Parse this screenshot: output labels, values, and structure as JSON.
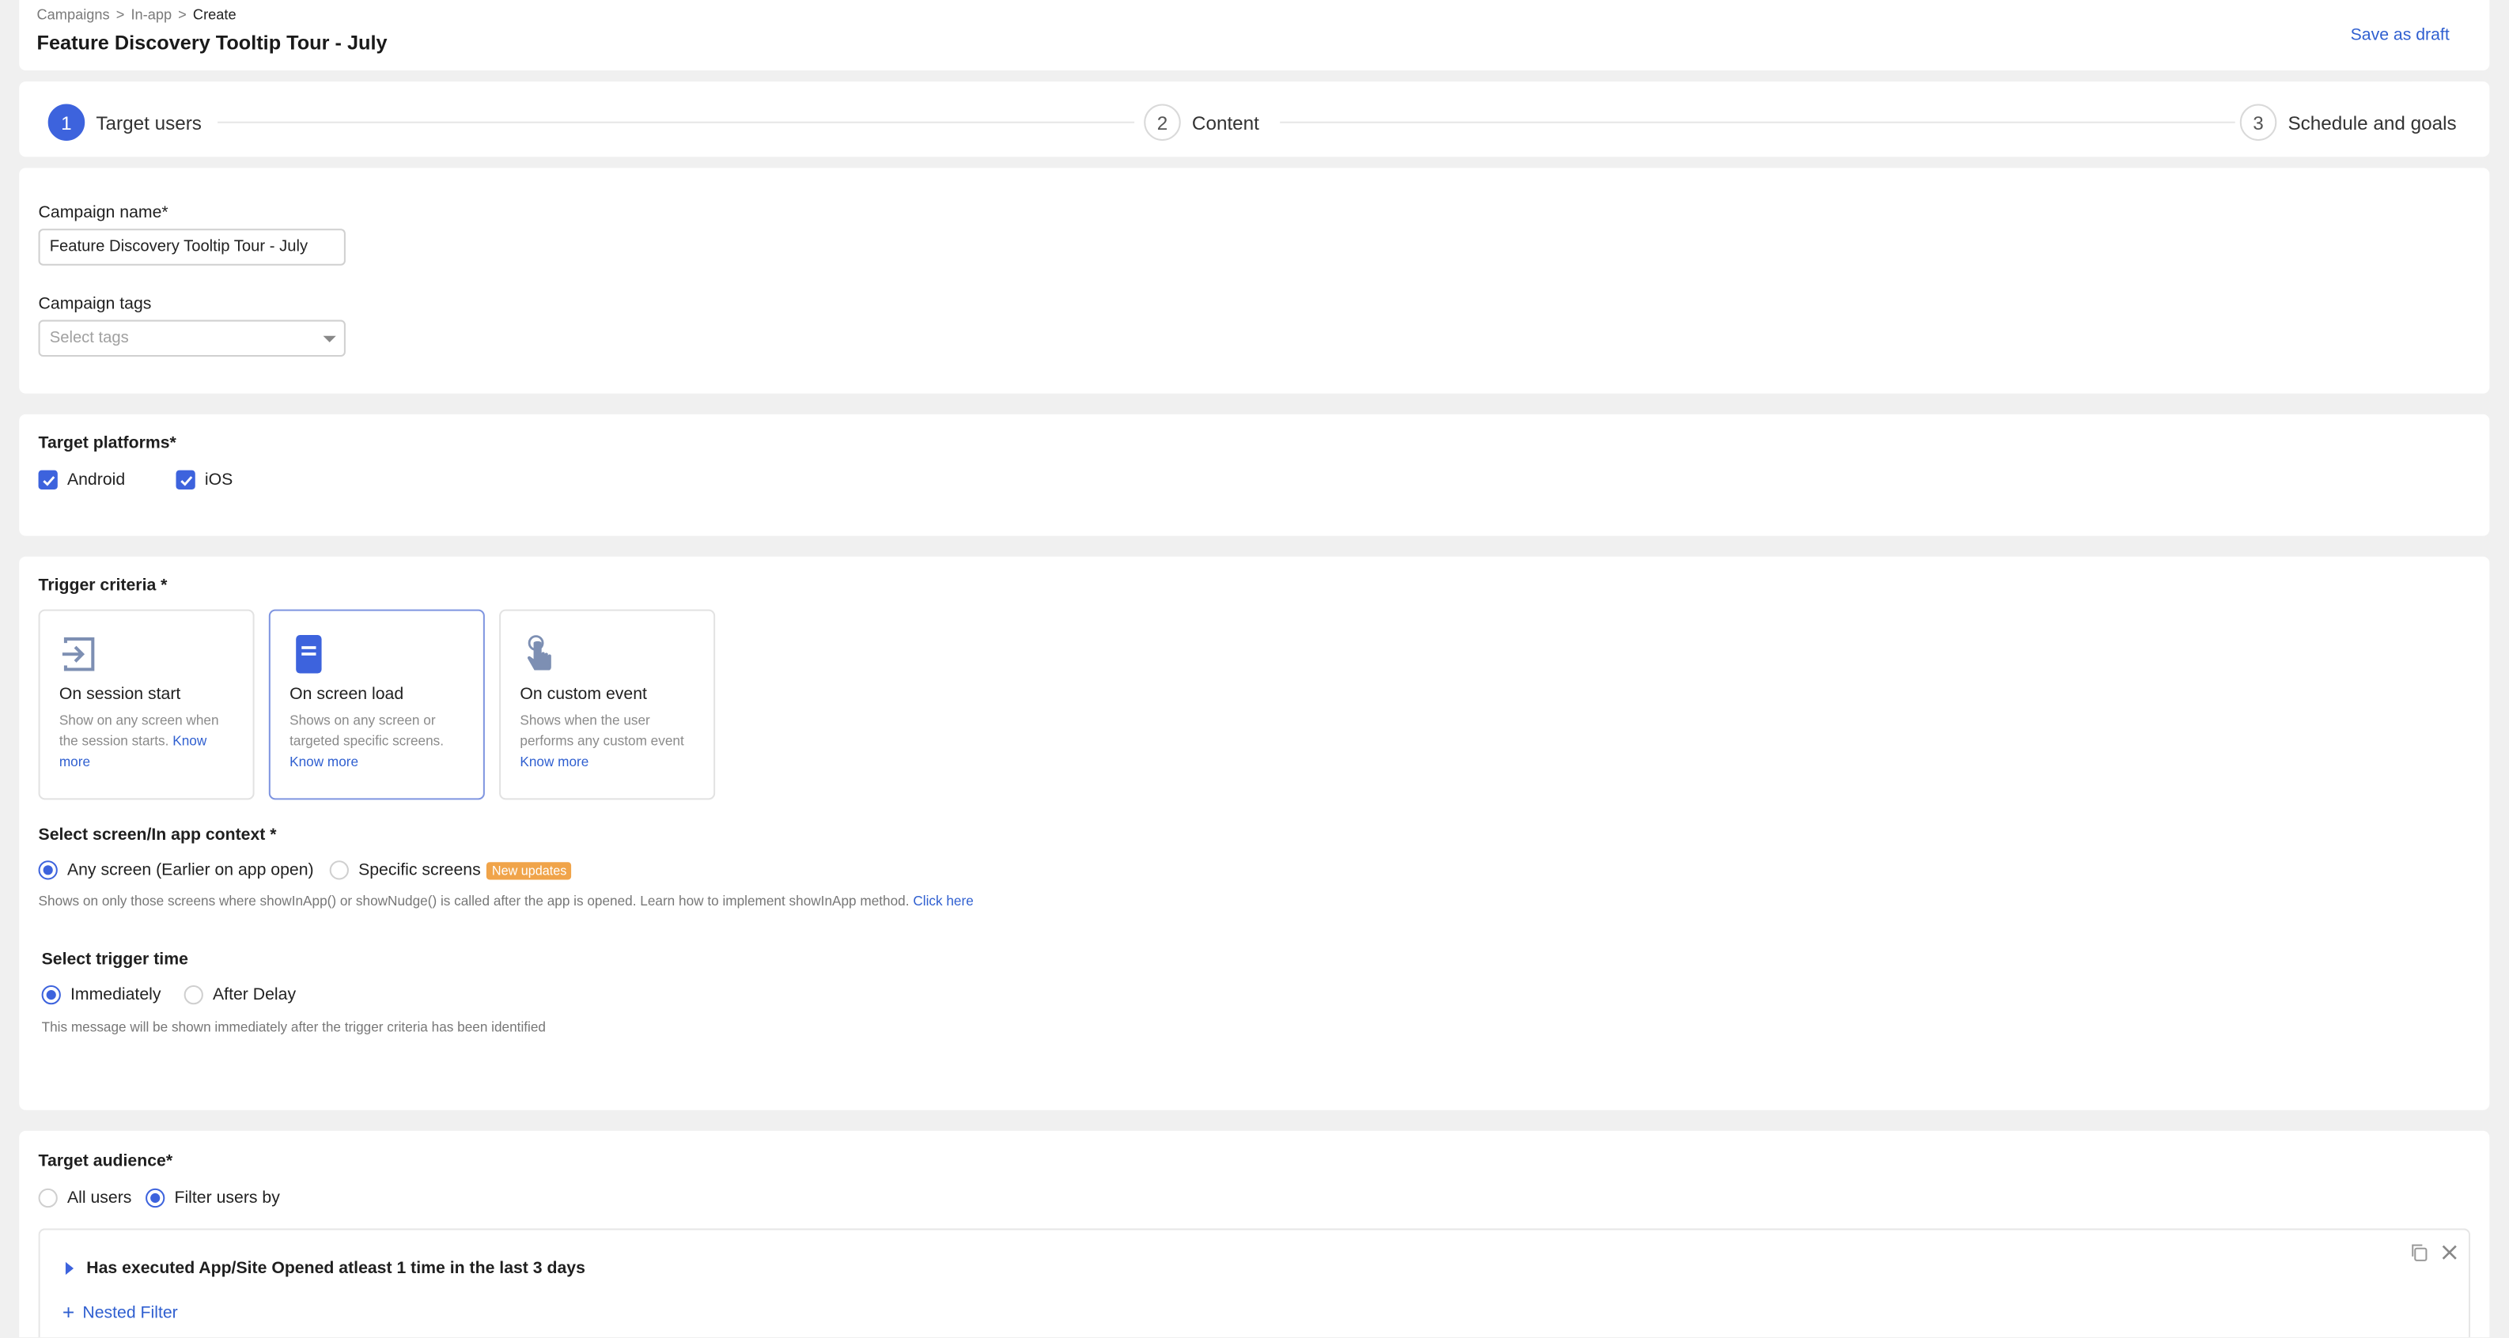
{
  "header": {
    "breadcrumb": [
      "Campaigns",
      "In-app",
      "Create"
    ],
    "breadcrumb_sep": ">",
    "title": "Feature Discovery Tooltip Tour - July",
    "save_draft": "Save as draft"
  },
  "steps": [
    {
      "num": "1",
      "label": "Target users",
      "active": true
    },
    {
      "num": "2",
      "label": "Content",
      "active": false
    },
    {
      "num": "3",
      "label": "Schedule and goals",
      "active": false
    }
  ],
  "campaign": {
    "name_label": "Campaign name*",
    "name_value": "Feature Discovery Tooltip Tour - July",
    "tags_label": "Campaign tags",
    "tags_placeholder": "Select tags"
  },
  "platforms": {
    "label": "Target platforms*",
    "android": "Android",
    "ios": "iOS"
  },
  "trigger": {
    "label": "Trigger criteria *",
    "tiles": [
      {
        "title": "On session start",
        "desc": "Show on any screen when the session starts.",
        "link": "Know more"
      },
      {
        "title": "On screen load",
        "desc": "Shows on any screen or targeted specific screens.",
        "link": "Know more"
      },
      {
        "title": "On custom event",
        "desc": "Shows when the user performs any custom event",
        "link": "Know more"
      }
    ]
  },
  "screen_context": {
    "label": "Select screen/In app context *",
    "any_screen": "Any screen (Earlier on app open)",
    "specific": "Specific screens",
    "badge": "New updates",
    "hint": "Shows on only those screens where showInApp() or showNudge() is called after the app is opened. Learn how to implement showInApp method.",
    "hint_link": "Click here"
  },
  "trigger_time": {
    "label": "Select trigger time",
    "immediately": "Immediately",
    "after_delay": "After Delay",
    "hint": "This message will be shown immediately after the trigger criteria has been identified"
  },
  "audience": {
    "label": "Target audience*",
    "all_users": "All users",
    "filter_users": "Filter users by",
    "filter_text": "Has executed App/Site Opened atleast 1 time in the last 3 days",
    "nested": "Nested Filter",
    "plus": "+"
  },
  "colors": {
    "accent": "#3d63dd",
    "link": "#2f5fd0",
    "badge": "#f0a44a"
  }
}
